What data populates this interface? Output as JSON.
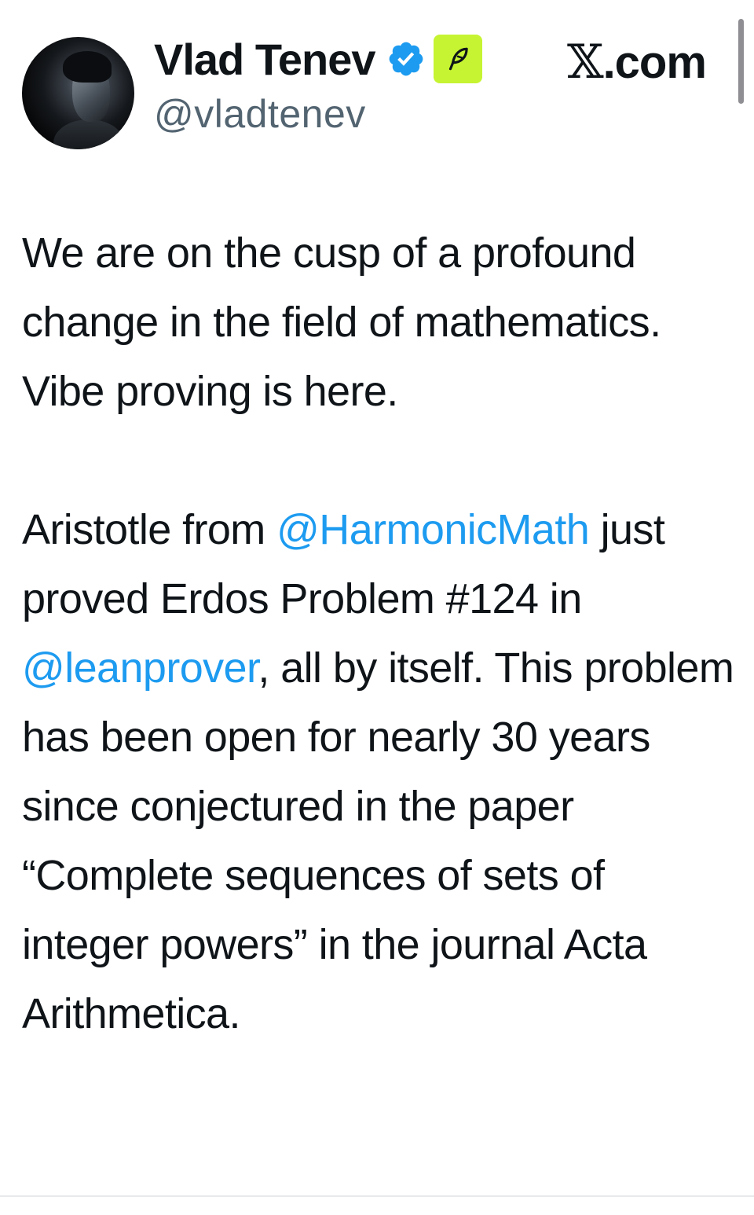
{
  "author": {
    "display_name": "Vlad Tenev",
    "handle": "@vladtenev",
    "verified_color": "#1d9bf0",
    "affiliate_badge_color": "#c6f432",
    "affiliate_badge_icon": "feather-icon"
  },
  "site": {
    "x_mark": "𝕏",
    "domain_suffix": ".com"
  },
  "tweet": {
    "para1": "We are on the cusp of a profound change in the field of mathematics. Vibe proving is here.",
    "para2_lead": "Aristotle from ",
    "mention_harmonic": "@HarmonicMath",
    "para2_mid": " just proved Erdos Problem #124 in ",
    "mention_lean": "@leanprover",
    "para2_tail": ", all by itself. This problem has been open for nearly 30 years since conjectured in the paper “Complete sequences of sets of integer powers” in the journal Acta Arithmetica."
  },
  "colors": {
    "text": "#0f1419",
    "secondary_text": "#536471",
    "link": "#1d9bf0"
  }
}
